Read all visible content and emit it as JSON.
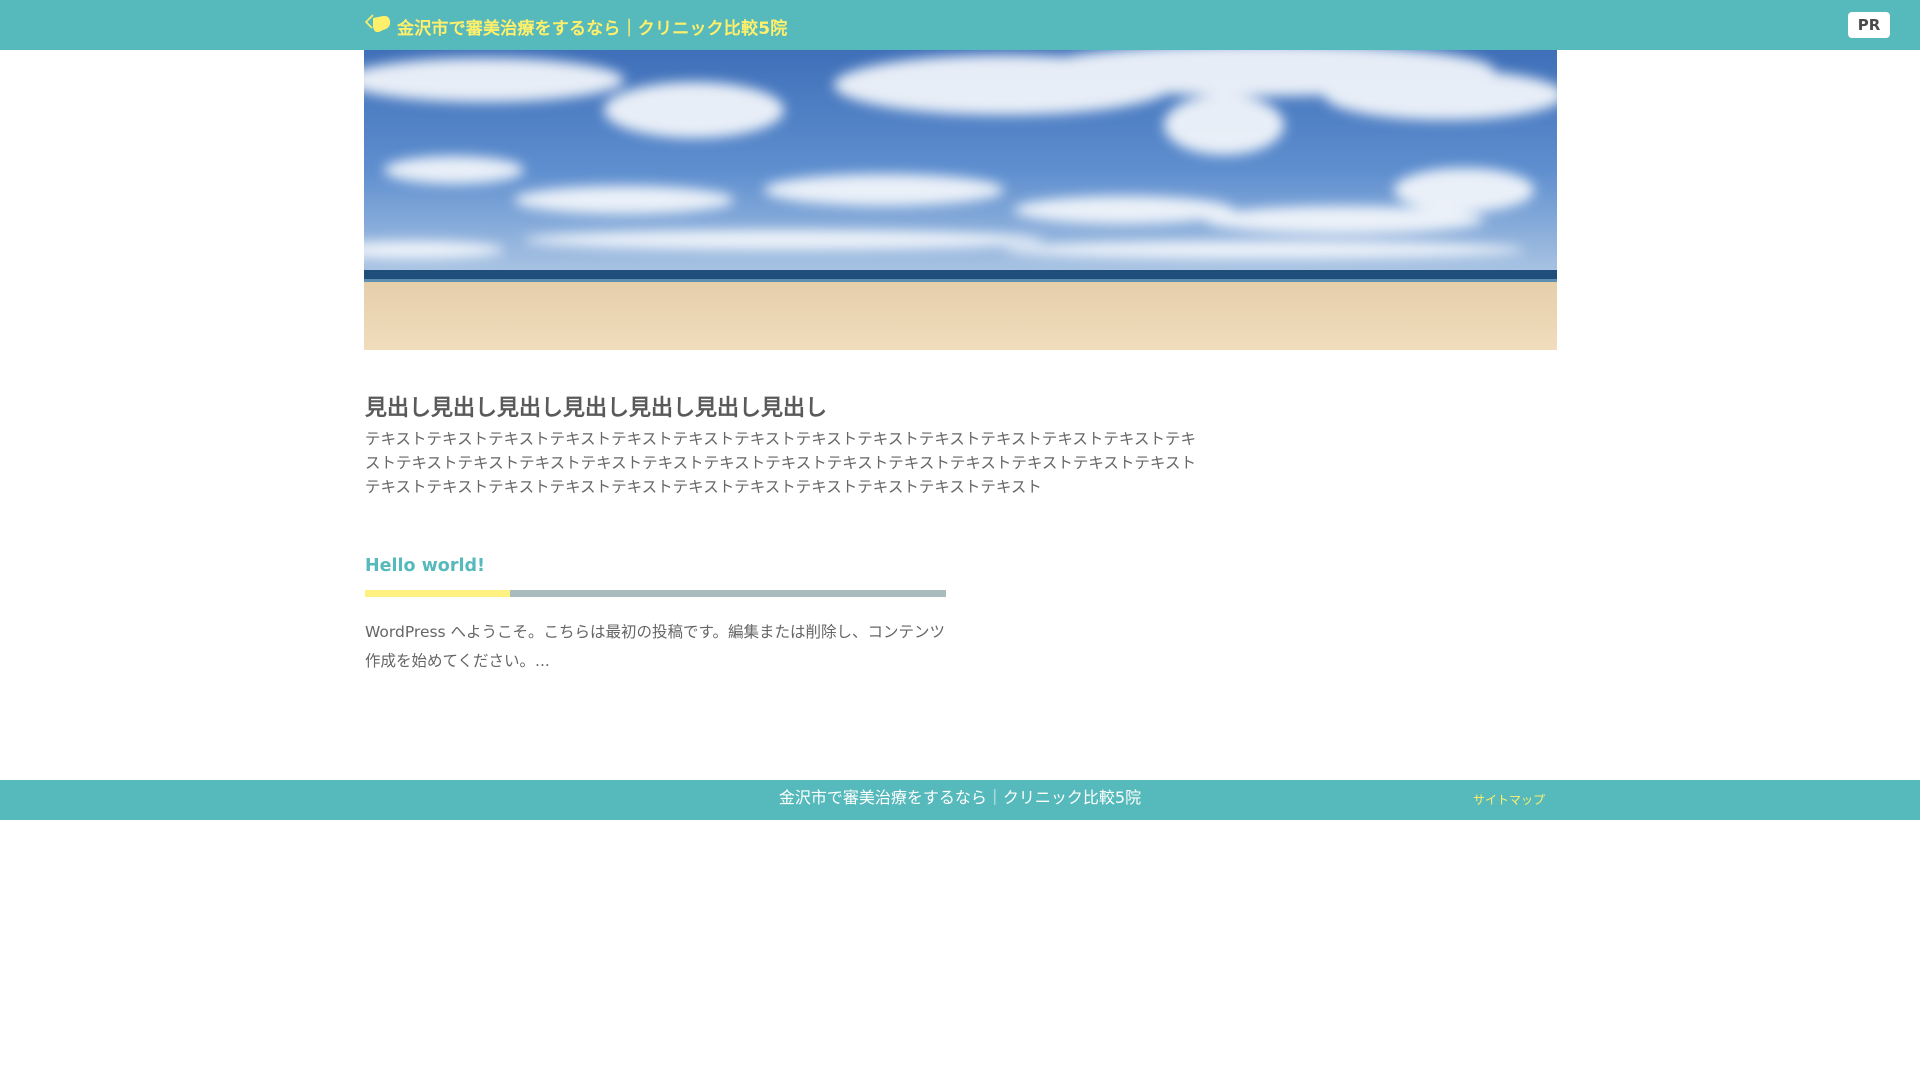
{
  "header": {
    "site_title": "金沢市で審美治療をするなら｜クリニック比較5院",
    "pr_label": "PR",
    "colors": {
      "bar": "#56b9bb",
      "title": "#fff06c"
    }
  },
  "hero": {
    "image_alt": "beach-and-sky"
  },
  "lead": {
    "heading": "見出し見出し見出し見出し見出し見出し見出し",
    "text": "テキストテキストテキストテキストテキストテキストテキストテキストテキストテキストテキストテキストテキストテキストテキストテキストテキストテキストテキストテキストテキストテキストテキストテキストテキストテキストテキストテキストテキストテキストテキストテキストテキストテキストテキストテキストテキストテキスト"
  },
  "post": {
    "title": "Hello world!",
    "excerpt": "WordPress へようこそ。こちらは最初の投稿です。編集または削除し、コンテンツ作成を始めてください。..."
  },
  "footer": {
    "copyright": "金沢市で審美治療をするなら｜クリニック比較5院",
    "sitemap_icon": "",
    "sitemap_label": "サイトマップ"
  }
}
